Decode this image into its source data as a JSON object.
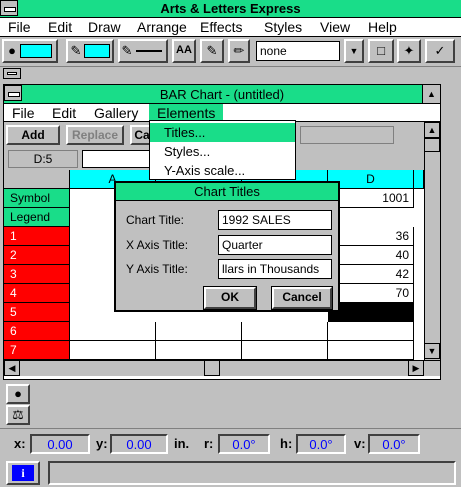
{
  "app": {
    "title": "Arts & Letters Express",
    "menu": [
      "File",
      "Edit",
      "Draw",
      "Arrange",
      "Effects",
      "Styles",
      "View",
      "Help"
    ]
  },
  "toolbar": {
    "line_style_value": "none",
    "font_button_label": "AA",
    "accent_color": "#00ffff"
  },
  "chart_window": {
    "title": "BAR Chart - (untitled)",
    "menu": [
      "File",
      "Edit",
      "Gallery",
      "Elements"
    ],
    "buttons": [
      "Add",
      "Replace",
      "Ca"
    ],
    "cell_ref": "D:5",
    "column_headers": [
      "A",
      "D"
    ],
    "row_headers": [
      "Symbol",
      "Legend",
      "1",
      "2",
      "3",
      "4",
      "5",
      "6",
      "7"
    ],
    "column_d_values": [
      "1001",
      "",
      "36",
      "40",
      "42",
      "70",
      "",
      "",
      ""
    ]
  },
  "elements_menu": {
    "items": [
      "Titles...",
      "Styles...",
      "Y-Axis scale..."
    ]
  },
  "dialog": {
    "title": "Chart Titles",
    "chart_title_label": "Chart Title:",
    "chart_title_value": "1992 SALES",
    "x_axis_label": "X Axis Title:",
    "x_axis_value": "Quarter",
    "y_axis_label": "Y Axis Title:",
    "y_axis_value": "llars in Thousands",
    "ok_label": "OK",
    "cancel_label": "Cancel"
  },
  "status": {
    "x_label": "x:",
    "x_value": "0.00",
    "y_label": "y:",
    "y_value": "0.00",
    "unit": "in.",
    "r_label": "r:",
    "r_value": "0.0°",
    "h_label": "h:",
    "h_value": "0.0°",
    "v_label": "v:",
    "v_value": "0.0°",
    "info_icon": "i"
  }
}
